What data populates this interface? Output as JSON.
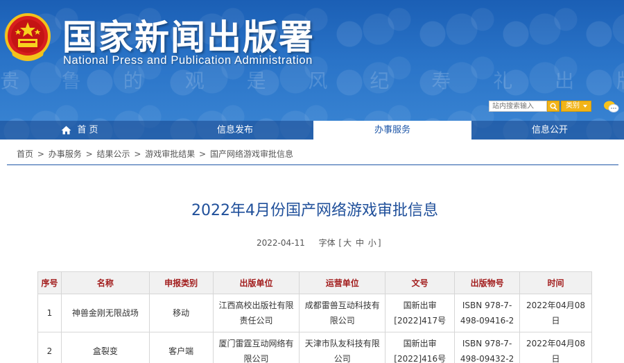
{
  "header": {
    "site_title": "国家新闻出版署",
    "site_subtitle": "National Press and Publication Administration",
    "background_glyphs": "贵 鲁 的 观 是 风 纪 寿 礼 出 版",
    "search_placeholder": "站内搜索输入",
    "category_label": "类别",
    "accent_color": "#1f57a8",
    "search_button_color": "#f2b418"
  },
  "nav": {
    "items": [
      {
        "label": "首 页",
        "icon": "home-icon"
      },
      {
        "label": "信息发布"
      },
      {
        "label": "办事服务",
        "active": true
      },
      {
        "label": "信息公开"
      }
    ]
  },
  "breadcrumb": [
    "首页",
    "办事服务",
    "结果公示",
    "游戏审批结果",
    "国产网络游戏审批信息"
  ],
  "breadcrumb_separator": ">",
  "article": {
    "title": "2022年4月份国产网络游戏审批信息",
    "date": "2022-04-11",
    "font_label": "字体",
    "font_sizes": [
      "大",
      "中",
      "小"
    ],
    "font_open": "[",
    "font_close": "]"
  },
  "table": {
    "headers": [
      "序号",
      "名称",
      "申报类别",
      "出版单位",
      "运营单位",
      "文号",
      "出版物号",
      "时间"
    ],
    "rows": [
      [
        "1",
        "神兽金刚无限战场",
        "移动",
        "江西高校出版社有限责任公司",
        "成都雷兽互动科技有限公司",
        "国新出审[2022]417号",
        "ISBN 978-7-498-09416-2",
        "2022年04月08日"
      ],
      [
        "2",
        "盒裂变",
        "客户端",
        "厦门雷霆互动网络有限公司",
        "天津市队友科技有限公司",
        "国新出审[2022]416号",
        "ISBN 978-7-498-09432-2",
        "2022年04月08日"
      ]
    ]
  }
}
